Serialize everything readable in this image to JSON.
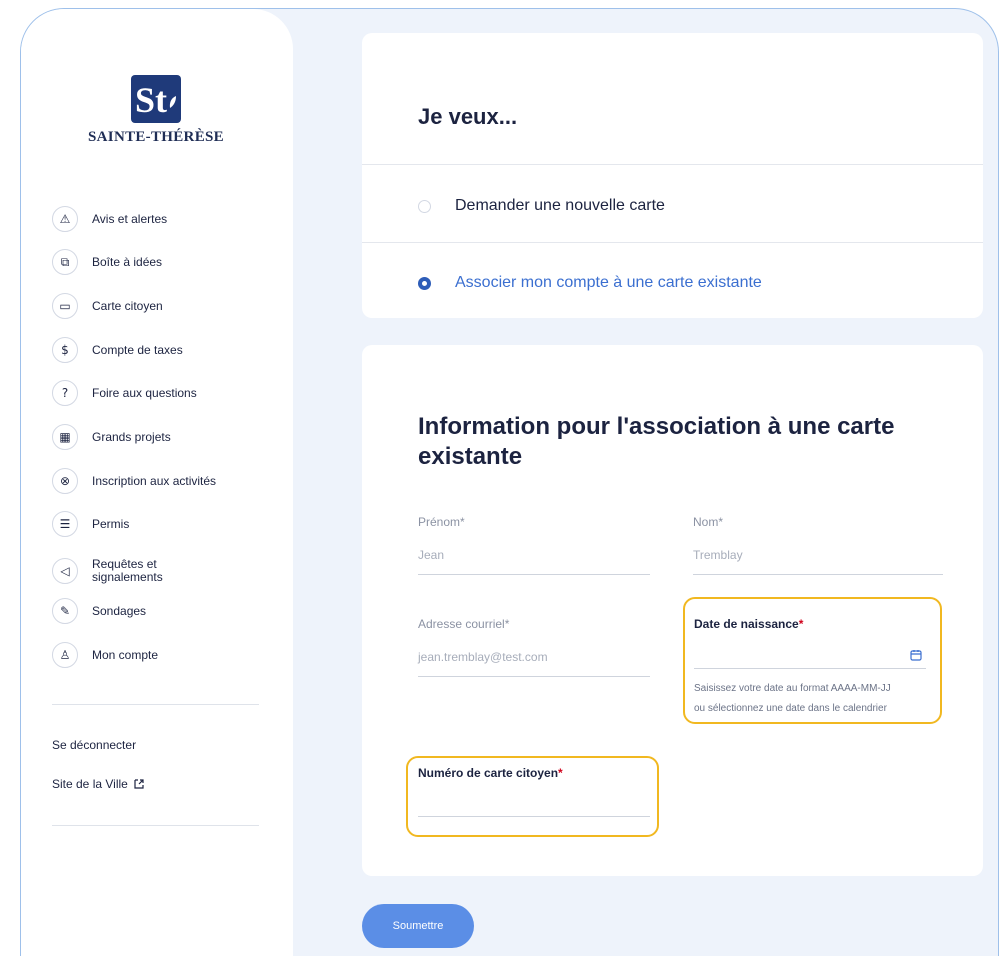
{
  "brand": {
    "name": "SAINTE-THÉRÈSE",
    "logo_letters": "St",
    "primary_color": "#1f3a7a",
    "accent_color": "#3b6fd0",
    "highlight_color": "#f1b820"
  },
  "sidebar": {
    "items": [
      {
        "label": "Avis et alertes",
        "icon": "warning-icon",
        "glyph": "⚠"
      },
      {
        "label": "Boîte à idées",
        "icon": "idea-box-icon",
        "glyph": "⧉"
      },
      {
        "label": "Carte citoyen",
        "icon": "card-icon",
        "glyph": "▭"
      },
      {
        "label": "Compte de taxes",
        "icon": "dollar-icon",
        "glyph": "$"
      },
      {
        "label": "Foire aux questions",
        "icon": "question-icon",
        "glyph": "?"
      },
      {
        "label": "Grands projets",
        "icon": "building-icon",
        "glyph": "▦"
      },
      {
        "label": "Inscription aux activités",
        "icon": "activity-ball-icon",
        "glyph": "⊗"
      },
      {
        "label": "Permis",
        "icon": "clipboard-icon",
        "glyph": "☰"
      },
      {
        "label": "Requêtes et\nsignalements",
        "icon": "megaphone-icon",
        "glyph": "◁"
      },
      {
        "label": "Sondages",
        "icon": "edit-icon",
        "glyph": "✎"
      },
      {
        "label": "Mon compte",
        "icon": "user-icon",
        "glyph": "♙"
      }
    ],
    "logout": "Se déconnecter",
    "city_site": "Site de la Ville"
  },
  "choice": {
    "title": "Je veux...",
    "options": [
      {
        "label": "Demander une nouvelle carte",
        "checked": false
      },
      {
        "label": "Associer mon compte à une carte existante",
        "checked": true
      }
    ]
  },
  "form": {
    "title": "Information pour l'association à une carte existante",
    "first_name": {
      "label": "Prénom*",
      "value": "Jean"
    },
    "last_name": {
      "label": "Nom*",
      "value": "Tremblay"
    },
    "email": {
      "label": "Adresse courriel*",
      "value": "jean.tremblay@test.com"
    },
    "birth_date": {
      "label": "Date de naissance",
      "required": "*",
      "helper_line1": "Saisissez votre date au format AAAA-MM-JJ",
      "helper_line2": "ou sélectionnez une date dans le calendrier"
    },
    "card_number": {
      "label": "Numéro de carte citoyen",
      "required": "*"
    }
  },
  "submit_label": "Soumettre"
}
